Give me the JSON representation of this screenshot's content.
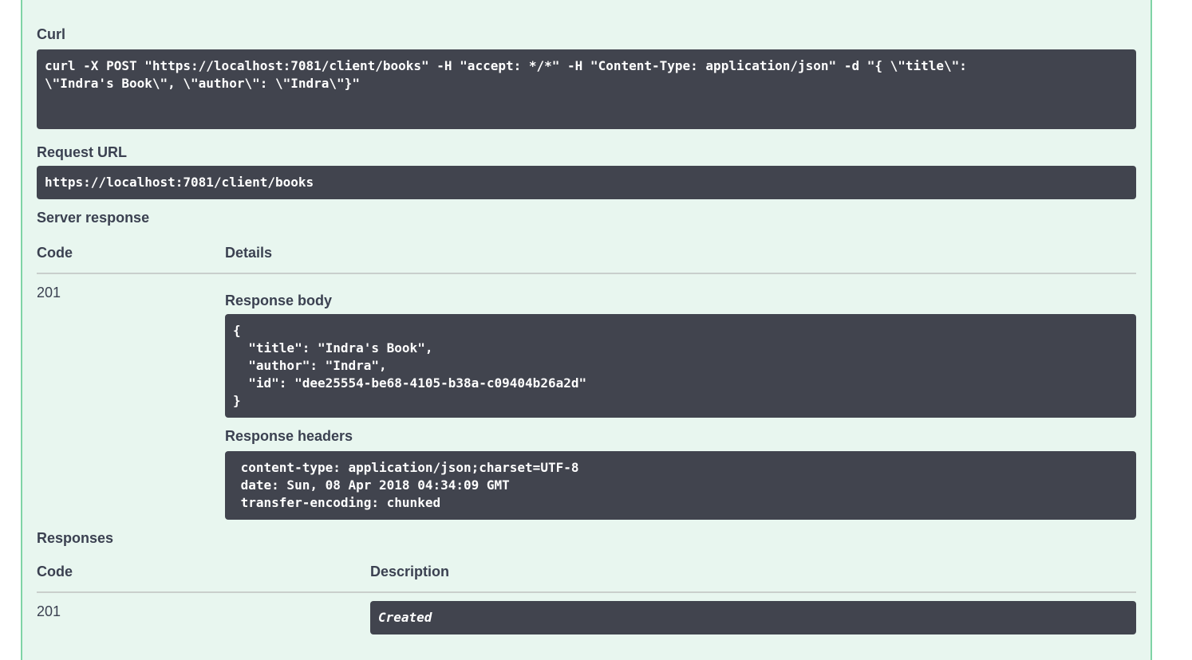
{
  "curl": {
    "label": "Curl",
    "command": "curl -X POST \"https://localhost:7081/client/books\" -H \"accept: */*\" -H \"Content-Type: application/json\" -d \"{ \\\"title\\\":\n\\\"Indra's Book\\\", \\\"author\\\": \\\"Indra\\\"}\""
  },
  "request_url": {
    "label": "Request URL",
    "value": "https://localhost:7081/client/books"
  },
  "server_response": {
    "label": "Server response",
    "code_header": "Code",
    "details_header": "Details",
    "code": "201",
    "response_body_label": "Response body",
    "response_body": "{\n  \"title\": \"Indra's Book\",\n  \"author\": \"Indra\",\n  \"id\": \"dee25554-be68-4105-b38a-c09404b26a2d\"\n}",
    "response_headers_label": "Response headers",
    "response_headers": " content-type: application/json;charset=UTF-8\n date: Sun, 08 Apr 2018 04:34:09 GMT\n transfer-encoding: chunked"
  },
  "responses": {
    "label": "Responses",
    "code_header": "Code",
    "description_header": "Description",
    "code": "201",
    "description": "Created"
  }
}
